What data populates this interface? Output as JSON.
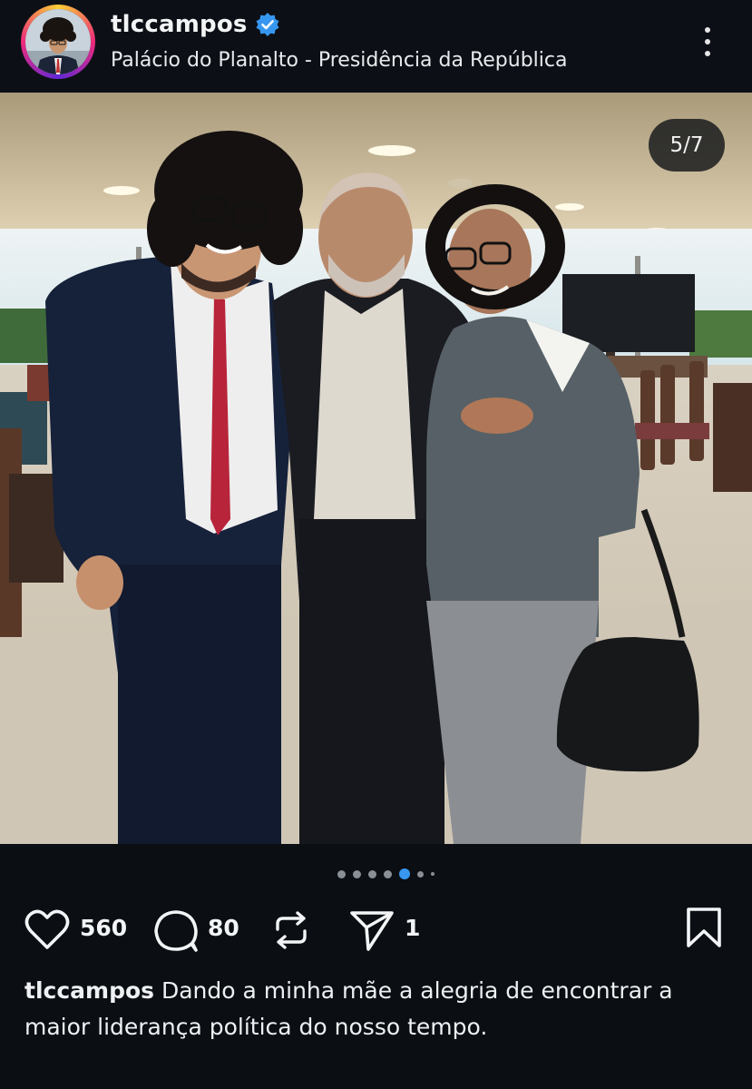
{
  "post": {
    "username": "tlccampos",
    "location": "Palácio do Planalto - Presidência da República",
    "slide_counter": "5/7",
    "image_alt": "",
    "carousel": {
      "total": 7,
      "active_index": 4
    },
    "likes": "560",
    "comments": "80",
    "shares": "1",
    "caption_user": "tlccampos",
    "caption_text": " Dando a minha mãe a alegria de encontrar a maior liderança política do nosso tempo."
  },
  "icons": {
    "verified": "verified-badge-icon",
    "more": "more-options-icon",
    "like": "heart-icon",
    "comment": "comment-icon",
    "repost": "repost-icon",
    "share": "send-icon",
    "save": "bookmark-icon"
  },
  "colors": {
    "background": "#0b0f14",
    "verified": "#3797f0",
    "active_dot": "#3897f0"
  }
}
